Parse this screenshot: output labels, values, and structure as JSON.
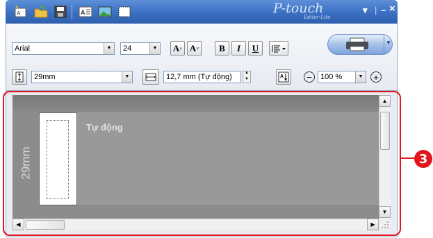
{
  "titlebar": {
    "logo_main": "P-touch",
    "logo_sub": "Editor Lite",
    "minimize": "–",
    "close": "×",
    "menu_arrow": "▾"
  },
  "toolbar": {
    "font_name": "Arial",
    "font_size": "24",
    "increase_font_label": "A",
    "decrease_font_label": "A",
    "bold_label": "B",
    "italic_label": "I",
    "underline_label": "U",
    "tape_width": "29mm",
    "label_length": "12,7 mm (Tự động)",
    "zoom": "100 %",
    "zoom_out": "−",
    "zoom_in": "+"
  },
  "editor": {
    "tape_width_label": "29mm",
    "auto_label": "Tự động"
  },
  "callout": {
    "number": "3"
  },
  "colors": {
    "titlebar": "#3b6fc2",
    "highlight": "#e3141c",
    "canvas": "#8c8c8c"
  }
}
